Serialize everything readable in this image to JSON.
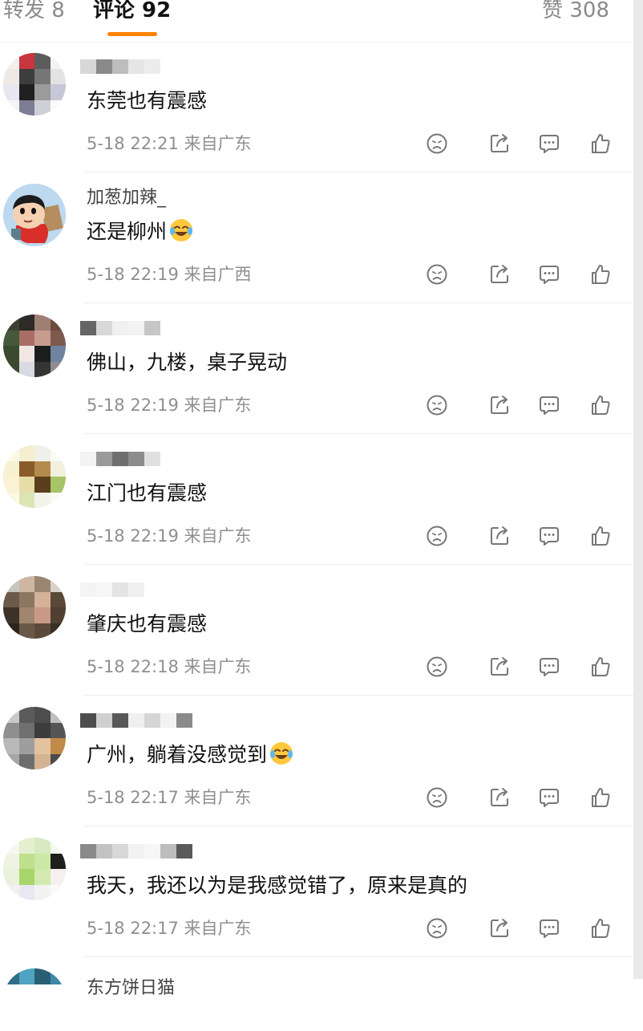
{
  "tabs": {
    "repost": "转发 8",
    "comments": "评论 92",
    "likes": "赞 308"
  },
  "icons": {
    "dislike": "dislike-face-icon",
    "share": "share-icon",
    "reply": "comment-bubble-icon",
    "like": "thumbs-up-icon"
  },
  "comments": [
    {
      "username": "",
      "text": "东莞也有震感",
      "emoji": "",
      "meta": "5-18 22:21 来自广东"
    },
    {
      "username": "加葱加辣_",
      "text": "还是柳州",
      "emoji": "laugh-cry-emoji",
      "meta": "5-18 22:19 来自广西"
    },
    {
      "username": "",
      "text": "佛山，九楼，桌子晃动",
      "emoji": "",
      "meta": "5-18 22:19 来自广东"
    },
    {
      "username": "",
      "text": "江门也有震感",
      "emoji": "",
      "meta": "5-18 22:19 来自广东"
    },
    {
      "username": "",
      "text": "肇庆也有震感",
      "emoji": "",
      "meta": "5-18 22:18 来自广东"
    },
    {
      "username": "",
      "text": "广州，躺着没感觉到",
      "emoji": "laugh-cry-emoji",
      "meta": "5-18 22:17 来自广东"
    },
    {
      "username": "",
      "text": "我天，我还以为是我感觉错了，原来是真的",
      "emoji": "",
      "meta": "5-18 22:17 来自广东"
    }
  ],
  "partial_comment": {
    "username": "东方饼日猫"
  },
  "colors": {
    "accent": "#ff8200",
    "meta_text": "#8f8f8f",
    "divider": "#ececec"
  }
}
